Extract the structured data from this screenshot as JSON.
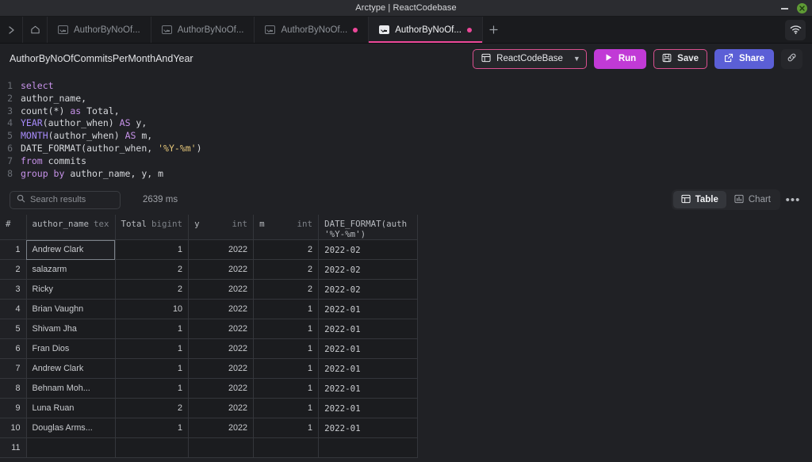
{
  "window": {
    "title": "Arctype | ReactCodebase",
    "minimize_icon": "minimize-icon",
    "close_icon": "close-icon"
  },
  "tabbar": {
    "expand_icon": "chevron-right-icon",
    "home_icon": "home-icon",
    "add_icon": "plus-icon",
    "wifi_icon": "wifi-icon",
    "tabs": [
      {
        "label": "AuthorByNoOf...",
        "active": false,
        "dirty": false
      },
      {
        "label": "AuthorByNoOf...",
        "active": false,
        "dirty": false
      },
      {
        "label": "AuthorByNoOf...",
        "active": false,
        "dirty": true
      },
      {
        "label": "AuthorByNoOf...",
        "active": true,
        "dirty": true
      }
    ]
  },
  "query_header": {
    "title": "AuthorByNoOfCommitsPerMonthAndYear",
    "database_label": "ReactCodeBase",
    "database_icon": "database-icon",
    "caret_icon": "chevron-down-icon",
    "run_label": "Run",
    "run_icon": "play-icon",
    "save_label": "Save",
    "save_icon": "floppy-icon",
    "share_label": "Share",
    "share_icon": "external-link-icon",
    "link_icon": "link-icon"
  },
  "editor": {
    "lines": [
      {
        "n": "1",
        "tokens": [
          {
            "t": "select",
            "c": "k-kw"
          }
        ]
      },
      {
        "n": "2",
        "tokens": [
          {
            "t": "author_name,",
            "c": "k-pl"
          }
        ]
      },
      {
        "n": "3",
        "tokens": [
          {
            "t": "count",
            "c": "k-pl"
          },
          {
            "t": "(*) ",
            "c": "k-pl"
          },
          {
            "t": "as",
            "c": "k-kw"
          },
          {
            "t": " Total,",
            "c": "k-pl"
          }
        ]
      },
      {
        "n": "4",
        "tokens": [
          {
            "t": "YEAR",
            "c": "k-fn"
          },
          {
            "t": "(author_when) ",
            "c": "k-pl"
          },
          {
            "t": "AS",
            "c": "k-kw"
          },
          {
            "t": " y,",
            "c": "k-pl"
          }
        ]
      },
      {
        "n": "5",
        "tokens": [
          {
            "t": "MONTH",
            "c": "k-fn"
          },
          {
            "t": "(author_when) ",
            "c": "k-pl"
          },
          {
            "t": "AS",
            "c": "k-kw"
          },
          {
            "t": " m,",
            "c": "k-pl"
          }
        ]
      },
      {
        "n": "6",
        "tokens": [
          {
            "t": "DATE_FORMAT(author_when, ",
            "c": "k-pl"
          },
          {
            "t": "'%Y-%m'",
            "c": "k-str"
          },
          {
            "t": ")",
            "c": "k-pl"
          }
        ]
      },
      {
        "n": "7",
        "tokens": [
          {
            "t": "from",
            "c": "k-kw"
          },
          {
            "t": " commits",
            "c": "k-pl"
          }
        ]
      },
      {
        "n": "8",
        "tokens": [
          {
            "t": "group by",
            "c": "k-kw"
          },
          {
            "t": " author_name, y, m",
            "c": "k-pl"
          }
        ]
      }
    ]
  },
  "results_toolbar": {
    "search_placeholder": "Search results",
    "search_value": "",
    "search_icon": "search-icon",
    "duration": "2639 ms",
    "table_label": "Table",
    "table_icon": "table-icon",
    "chart_label": "Chart",
    "chart_icon": "chart-icon",
    "more_icon": "ellipsis-icon"
  },
  "table": {
    "index_header": "#",
    "columns": [
      {
        "name": "author_name",
        "type": "tex",
        "sub": "",
        "align": "left"
      },
      {
        "name": "Total",
        "type": "bigint",
        "sub": "",
        "align": "right"
      },
      {
        "name": "y",
        "type": "int",
        "sub": "",
        "align": "right"
      },
      {
        "name": "m",
        "type": "int",
        "sub": "",
        "align": "right"
      },
      {
        "name": "DATE_FORMAT(auth",
        "type": "",
        "sub": "'%Y-%m')",
        "align": "left"
      }
    ],
    "rows": [
      {
        "i": "1",
        "cells": [
          "Andrew Clark",
          "1",
          "2022",
          "2",
          "2022-02"
        ],
        "selected": 0
      },
      {
        "i": "2",
        "cells": [
          "salazarm",
          "2",
          "2022",
          "2",
          "2022-02"
        ]
      },
      {
        "i": "3",
        "cells": [
          "Ricky",
          "2",
          "2022",
          "2",
          "2022-02"
        ]
      },
      {
        "i": "4",
        "cells": [
          "Brian Vaughn",
          "10",
          "2022",
          "1",
          "2022-01"
        ]
      },
      {
        "i": "5",
        "cells": [
          "Shivam Jha",
          "1",
          "2022",
          "1",
          "2022-01"
        ]
      },
      {
        "i": "6",
        "cells": [
          "Fran Dios",
          "1",
          "2022",
          "1",
          "2022-01"
        ]
      },
      {
        "i": "7",
        "cells": [
          "Andrew Clark",
          "1",
          "2022",
          "1",
          "2022-01"
        ]
      },
      {
        "i": "8",
        "cells": [
          "Behnam Moh...",
          "1",
          "2022",
          "1",
          "2022-01"
        ]
      },
      {
        "i": "9",
        "cells": [
          "Luna Ruan",
          "2",
          "2022",
          "1",
          "2022-01"
        ]
      },
      {
        "i": "10",
        "cells": [
          "Douglas Arms...",
          "1",
          "2022",
          "1",
          "2022-01"
        ]
      },
      {
        "i": "11",
        "cells": [
          "",
          "",
          "",
          "",
          ""
        ]
      }
    ]
  }
}
